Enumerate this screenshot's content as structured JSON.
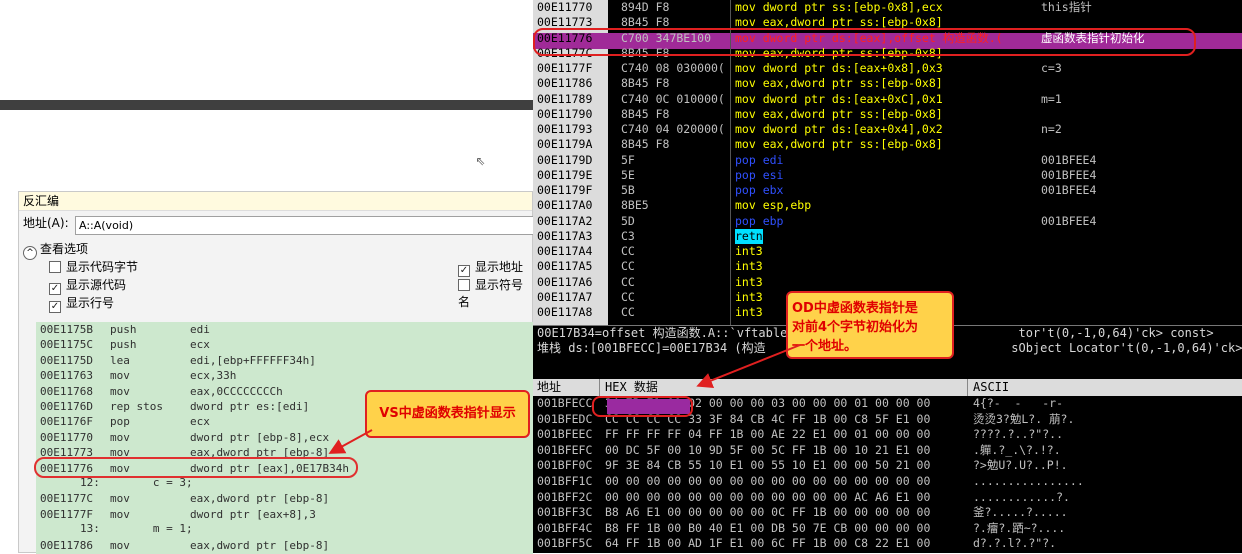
{
  "vs": {
    "title": "反汇编",
    "addr_label": "地址(A):",
    "addr_value": "A::A(void)",
    "view_options": "查看选项",
    "opts": [
      {
        "label": "显示代码字节",
        "checked": false
      },
      {
        "label": "显示源代码",
        "checked": true
      },
      {
        "label": "显示行号",
        "checked": true
      },
      {
        "label": "显示地址",
        "checked": true
      },
      {
        "label": "显示符号名",
        "checked": false
      }
    ],
    "lines": [
      {
        "a": "00E1175B",
        "m": "push",
        "o": "edi"
      },
      {
        "a": "00E1175C",
        "m": "push",
        "o": "ecx"
      },
      {
        "a": "00E1175D",
        "m": "lea",
        "o": "edi,[ebp+FFFFFF34h]"
      },
      {
        "a": "00E11763",
        "m": "mov",
        "o": "ecx,33h"
      },
      {
        "a": "00E11768",
        "m": "mov",
        "o": "eax,0CCCCCCCCh"
      },
      {
        "a": "00E1176D",
        "m": "rep stos",
        "o": "dword ptr es:[edi]"
      },
      {
        "a": "00E1176F",
        "m": "pop",
        "o": "ecx"
      },
      {
        "a": "00E11770",
        "m": "mov",
        "o": "dword ptr [ebp-8],ecx"
      },
      {
        "a": "00E11773",
        "m": "mov",
        "o": "eax,dword ptr [ebp-8]"
      },
      {
        "a": "00E11776",
        "m": "mov",
        "o": "dword ptr [eax],0E17B34h"
      },
      {
        "src": "12:        c = 3;"
      },
      {
        "a": "00E1177C",
        "m": "mov",
        "o": "eax,dword ptr [ebp-8]"
      },
      {
        "a": "00E1177F",
        "m": "mov",
        "o": "dword ptr [eax+8],3"
      },
      {
        "src": "13:        m = 1;"
      },
      {
        "a": "00E11786",
        "m": "mov",
        "o": "eax,dword ptr [ebp-8]"
      }
    ]
  },
  "callout_vs": "VS中虚函数表指针显示",
  "callout_od_lines": [
    "OD中虚函数表指针是",
    "对前4个字节初始化为",
    "一个地址。"
  ],
  "od": {
    "rows": [
      {
        "a": "00E11770",
        "h": "894D F8",
        "d": "mov dword ptr ss:[ebp-0x8],ecx",
        "c": "this指针",
        "dc": "#ffff00"
      },
      {
        "a": "00E11773",
        "h": "8B45 F8",
        "d": "mov eax,dword ptr ss:[ebp-0x8]",
        "c": "",
        "dc": "#ffff00"
      },
      {
        "a": "00E11776",
        "h": "C700 347BE100",
        "d": "mov dword ptr ds:[eax],offset 构造函数.(",
        "c": "虚函数表指针初始化",
        "dc": "#ffff00"
      },
      {
        "a": "00E1177C",
        "h": "8B45 F8",
        "d": "mov eax,dword ptr ss:[ebp-0x8]",
        "c": "",
        "dc": "#ffff00"
      },
      {
        "a": "00E1177F",
        "h": "C740 08 030000(",
        "d": "mov dword ptr ds:[eax+0x8],0x3",
        "c": "c=3",
        "dc": "#ffff00"
      },
      {
        "a": "00E11786",
        "h": "8B45 F8",
        "d": "mov eax,dword ptr ss:[ebp-0x8]",
        "c": "",
        "dc": "#ffff00"
      },
      {
        "a": "00E11789",
        "h": "C740 0C 010000(",
        "d": "mov dword ptr ds:[eax+0xC],0x1",
        "c": "m=1",
        "dc": "#ffff00"
      },
      {
        "a": "00E11790",
        "h": "8B45 F8",
        "d": "mov eax,dword ptr ss:[ebp-0x8]",
        "c": "",
        "dc": "#ffff00"
      },
      {
        "a": "00E11793",
        "h": "C740 04 020000(",
        "d": "mov dword ptr ds:[eax+0x4],0x2",
        "c": "n=2",
        "dc": "#ffff00"
      },
      {
        "a": "00E1179A",
        "h": "8B45 F8",
        "d": "mov eax,dword ptr ss:[ebp-0x8]",
        "c": "",
        "dc": "#ffff00"
      },
      {
        "a": "00E1179D",
        "h": "5F",
        "d": "pop edi",
        "c": "001BFEE4",
        "dc": "#ffff00"
      },
      {
        "a": "00E1179E",
        "h": "5E",
        "d": "pop esi",
        "c": "001BFEE4",
        "dc": "#ffff00"
      },
      {
        "a": "00E1179F",
        "h": "5B",
        "d": "pop ebx",
        "c": "001BFEE4",
        "dc": "#ffff00"
      },
      {
        "a": "00E117A0",
        "h": "8BE5",
        "d": "mov esp,ebp",
        "c": "",
        "dc": "#ffff00"
      },
      {
        "a": "00E117A2",
        "h": "5D",
        "d": "pop ebp",
        "c": "001BFEE4",
        "dc": "#ffff00"
      },
      {
        "a": "00E117A3",
        "h": "C3",
        "d": "retn",
        "c": "",
        "dc": "#000000"
      },
      {
        "a": "00E117A4",
        "h": "CC",
        "d": "int3",
        "c": "",
        "dc": "#ffff00"
      },
      {
        "a": "00E117A5",
        "h": "CC",
        "d": "int3",
        "c": "",
        "dc": "#ffff00"
      },
      {
        "a": "00E117A6",
        "h": "CC",
        "d": "int3",
        "c": "",
        "dc": "#ffff00"
      },
      {
        "a": "00E117A7",
        "h": "CC",
        "d": "int3",
        "c": "",
        "dc": "#ffff00"
      },
      {
        "a": "00E117A8",
        "h": "CC",
        "d": "int3",
        "c": "",
        "dc": "#ffff00"
      }
    ],
    "info1": "00E17B34=offset 构造函数.A::`vftable'                               tor't(0,-1,0,64)'ck> const>",
    "info2": "堆栈 ds:[001BFECC]=00E17B34 (构造                                  sObject Locator't(0,-1,0,64)'ck> const",
    "dump_headers": [
      "地址",
      "HEX 数据",
      "ASCII"
    ],
    "dump": [
      {
        "a": "001BFECC",
        "h": "34 7B E1 00 02 00 00 00 03 00 00 00 01 00 00 00",
        "s": "4{?-  -   -r-  "
      },
      {
        "a": "001BFEDC",
        "h": "CC CC CC CC 33 3F 84 CB 4C FF 1B 00 C8 5F E1 00",
        "s": "烫烫3?勉L?. 萠?."
      },
      {
        "a": "001BFEEC",
        "h": "FF FF FF FF 04 FF 1B 00 AE 22 E1 00 01 00 00 00",
        "s": "????.?..?\"?.."
      },
      {
        "a": "001BFEFC",
        "h": "00 DC 5F 00 10 9D 5F 00 5C FF 1B 00 10 21 E1 00",
        "s": ".軃.?_.\\?.!?."
      },
      {
        "a": "001BFF0C",
        "h": "9F 3E 84 CB 55 10 E1 00 55 10 E1 00 00 50 21 00",
        "s": "?>勉U?.U?..P!."
      },
      {
        "a": "001BFF1C",
        "h": "00 00 00 00 00 00 00 00 00 00 00 00 00 00 00 00",
        "s": "................"
      },
      {
        "a": "001BFF2C",
        "h": "00 00 00 00 00 00 00 00 00 00 00 00 AC A6 E1 00",
        "s": "............?."
      },
      {
        "a": "001BFF3C",
        "h": "B8 A6 E1 00 00 00 00 00 0C FF 1B 00 00 00 00 00",
        "s": "釜?.....?....."
      },
      {
        "a": "001BFF4C",
        "h": "B8 FF 1B 00 B0 40 E1 00 DB 50 7E CB 00 00 00 00",
        "s": "?.癅?.跴~?...."
      },
      {
        "a": "001BFF5C",
        "h": "64 FF 1B 00 AD 1F E1 00 6C FF 1B 00 C8 22 E1 00",
        "s": "d?.?.l?.?\"?."
      }
    ]
  }
}
